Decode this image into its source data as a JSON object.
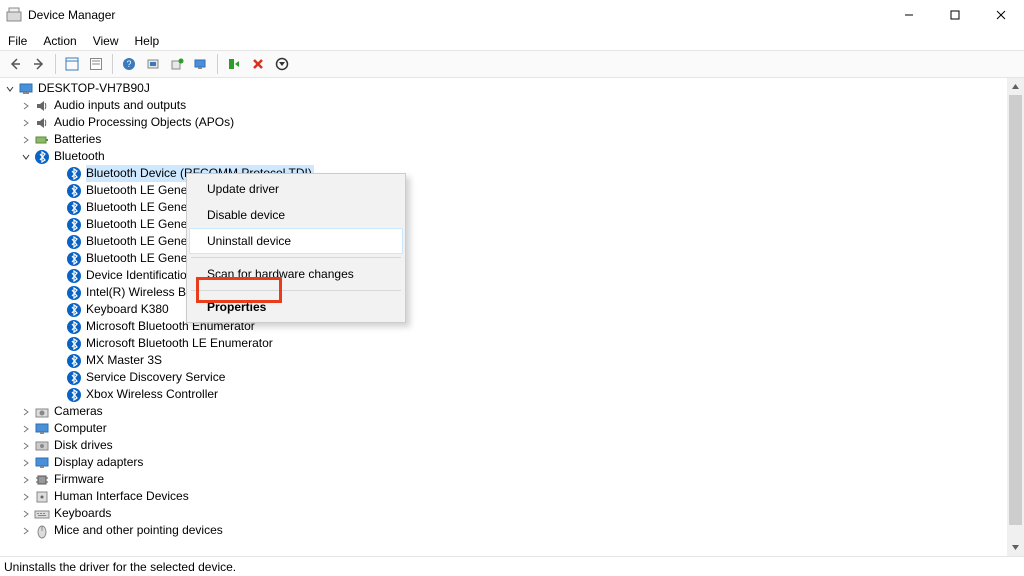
{
  "window": {
    "title": "Device Manager"
  },
  "menu": {
    "file": "File",
    "action": "Action",
    "view": "View",
    "help": "Help"
  },
  "root": {
    "label": "DESKTOP-VH7B90J"
  },
  "categories": [
    {
      "id": "audio-io",
      "label": "Audio inputs and outputs",
      "expanded": false,
      "icon": "speaker"
    },
    {
      "id": "apo",
      "label": "Audio Processing Objects (APOs)",
      "expanded": false,
      "icon": "speaker"
    },
    {
      "id": "batteries",
      "label": "Batteries",
      "expanded": false,
      "icon": "battery"
    },
    {
      "id": "bluetooth",
      "label": "Bluetooth",
      "expanded": true,
      "icon": "bluetooth",
      "children": [
        {
          "id": "bt-rfcomm",
          "label": "Bluetooth Device (RFCOMM Protocol TDI)",
          "selected": true
        },
        {
          "id": "bt-le-1",
          "label": "Bluetooth LE Generi"
        },
        {
          "id": "bt-le-2",
          "label": "Bluetooth LE Generi"
        },
        {
          "id": "bt-le-3",
          "label": "Bluetooth LE Generi"
        },
        {
          "id": "bt-le-4",
          "label": "Bluetooth LE Generi"
        },
        {
          "id": "bt-le-5",
          "label": "Bluetooth LE Generi"
        },
        {
          "id": "bt-devid",
          "label": "Device Identification"
        },
        {
          "id": "bt-intel",
          "label": "Intel(R) Wireless Blu"
        },
        {
          "id": "bt-k380",
          "label": "Keyboard K380"
        },
        {
          "id": "bt-enum",
          "label": "Microsoft Bluetooth Enumerator"
        },
        {
          "id": "bt-le-enum",
          "label": "Microsoft Bluetooth LE Enumerator"
        },
        {
          "id": "bt-mx",
          "label": "MX Master 3S"
        },
        {
          "id": "bt-sds",
          "label": "Service Discovery Service"
        },
        {
          "id": "bt-xbox",
          "label": "Xbox Wireless Controller"
        }
      ]
    },
    {
      "id": "cameras",
      "label": "Cameras",
      "expanded": false,
      "icon": "camera"
    },
    {
      "id": "computer",
      "label": "Computer",
      "expanded": false,
      "icon": "monitor"
    },
    {
      "id": "disk",
      "label": "Disk drives",
      "expanded": false,
      "icon": "disk"
    },
    {
      "id": "display",
      "label": "Display adapters",
      "expanded": false,
      "icon": "monitor"
    },
    {
      "id": "firmware",
      "label": "Firmware",
      "expanded": false,
      "icon": "chip"
    },
    {
      "id": "hid",
      "label": "Human Interface Devices",
      "expanded": false,
      "icon": "hid"
    },
    {
      "id": "keyboards",
      "label": "Keyboards",
      "expanded": false,
      "icon": "keyboard"
    },
    {
      "id": "mice",
      "label": "Mice and other pointing devices",
      "expanded": false,
      "icon": "mouse"
    }
  ],
  "context_menu": {
    "update": "Update driver",
    "disable": "Disable device",
    "uninstall": "Uninstall device",
    "scan": "Scan for hardware changes",
    "properties": "Properties"
  },
  "status": {
    "text": "Uninstalls the driver for the selected device."
  }
}
